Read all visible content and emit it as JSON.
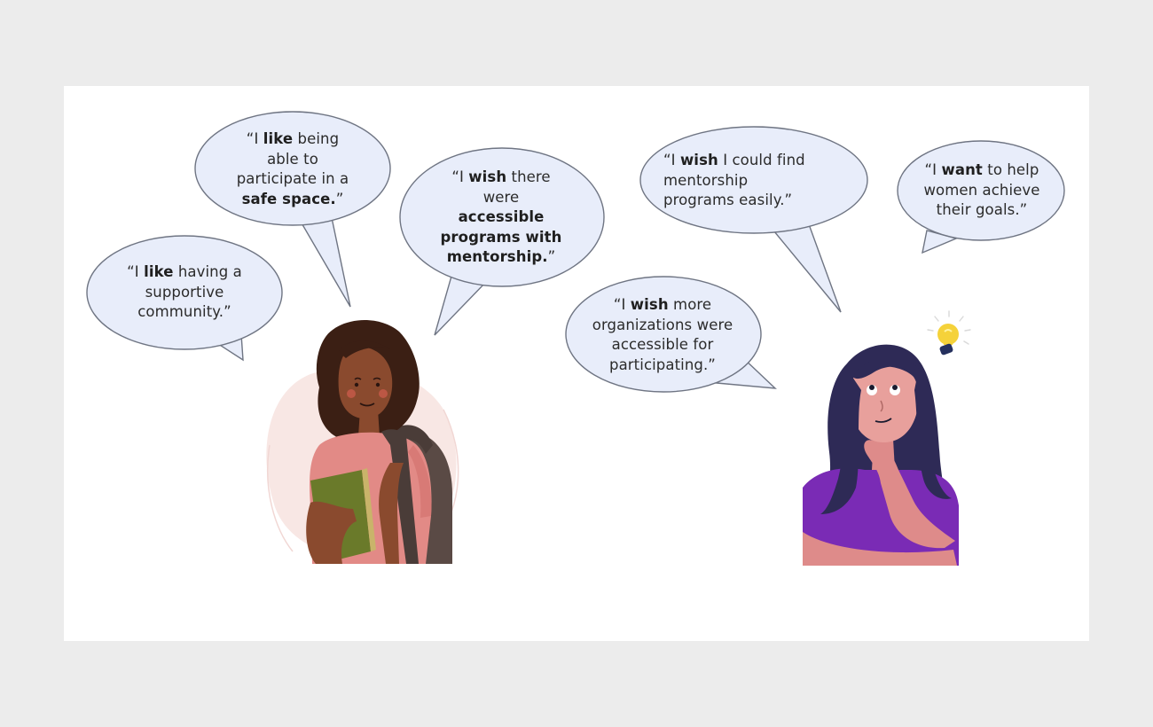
{
  "colors": {
    "page_background": "#ececec",
    "slide_background": "#ffffff",
    "bubble_fill": "#e8edfa",
    "bubble_stroke": "#6f7583",
    "text": "#2b2b2b"
  },
  "quotes": [
    {
      "id": "q1",
      "parts": [
        [
          "“I ",
          ""
        ],
        [
          "like",
          "b"
        ],
        [
          " having a",
          ""
        ],
        [
          "\n",
          ""
        ],
        [
          "supportive",
          ""
        ],
        [
          "\n",
          ""
        ],
        [
          "community.”",
          ""
        ]
      ]
    },
    {
      "id": "q2",
      "parts": [
        [
          "“I ",
          ""
        ],
        [
          "like",
          "b"
        ],
        [
          " being",
          ""
        ],
        [
          "\n",
          ""
        ],
        [
          "able to",
          ""
        ],
        [
          "\n",
          ""
        ],
        [
          "participate in a",
          ""
        ],
        [
          "\n",
          ""
        ],
        [
          "safe space.",
          "b"
        ],
        [
          "”",
          ""
        ]
      ]
    },
    {
      "id": "q3",
      "parts": [
        [
          "“I ",
          ""
        ],
        [
          "wish",
          "b"
        ],
        [
          " there",
          ""
        ],
        [
          "\n",
          ""
        ],
        [
          "were",
          ""
        ],
        [
          "\n",
          ""
        ],
        [
          "accessible",
          "b"
        ],
        [
          "\n",
          ""
        ],
        [
          "programs with",
          "b"
        ],
        [
          "\n",
          ""
        ],
        [
          "mentorship.",
          "b"
        ],
        [
          "”",
          ""
        ]
      ]
    },
    {
      "id": "q4",
      "parts": [
        [
          "“I ",
          ""
        ],
        [
          "wish",
          "b"
        ],
        [
          " I could find",
          ""
        ],
        [
          "\n",
          ""
        ],
        [
          "mentorship",
          ""
        ],
        [
          "\n",
          ""
        ],
        [
          "programs easily.”",
          ""
        ]
      ]
    },
    {
      "id": "q5",
      "parts": [
        [
          "“I ",
          ""
        ],
        [
          "want",
          "b"
        ],
        [
          " to help",
          ""
        ],
        [
          "\n",
          ""
        ],
        [
          "women achieve",
          ""
        ],
        [
          "\n",
          ""
        ],
        [
          "their goals.”",
          ""
        ]
      ]
    },
    {
      "id": "q6",
      "parts": [
        [
          "“I ",
          ""
        ],
        [
          "wish",
          "b"
        ],
        [
          " more",
          ""
        ],
        [
          "\n",
          ""
        ],
        [
          "organizations were",
          ""
        ],
        [
          "\n",
          ""
        ],
        [
          "accessible for",
          ""
        ],
        [
          "\n",
          ""
        ],
        [
          "participating.”",
          ""
        ]
      ]
    }
  ],
  "figures": {
    "student": {
      "icon": "student-woman-with-book-and-backpack-icon"
    },
    "thinker": {
      "icon": "thinking-woman-icon"
    },
    "idea": {
      "icon": "lightbulb-idea-icon"
    }
  }
}
